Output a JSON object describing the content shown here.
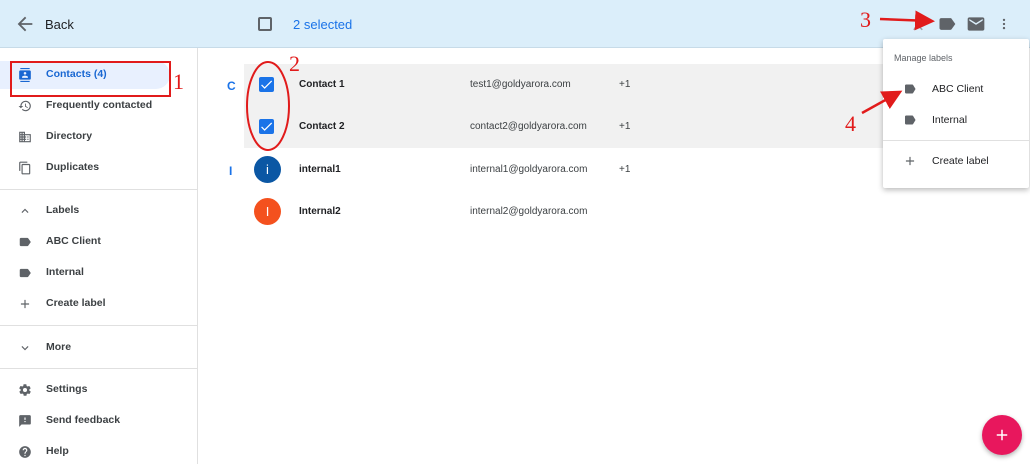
{
  "header": {
    "back_label": "Back",
    "selected_count": "2 selected",
    "icons": [
      "back-arrow-icon",
      "checkbox-icon",
      "merge-icon",
      "label-icon",
      "mail-icon",
      "more-vert-icon"
    ]
  },
  "sidebar": {
    "items": [
      {
        "label": "Contacts (4)",
        "icon": "contacts-icon",
        "active": true
      },
      {
        "label": "Frequently contacted",
        "icon": "history-icon"
      },
      {
        "label": "Directory",
        "icon": "directory-icon"
      },
      {
        "label": "Duplicates",
        "icon": "copy-icon"
      }
    ],
    "labels_section": {
      "title": "Labels",
      "items": [
        {
          "label": "ABC Client",
          "icon": "label-icon"
        },
        {
          "label": "Internal",
          "icon": "label-icon"
        },
        {
          "label": "Create label",
          "icon": "plus-icon"
        }
      ]
    },
    "more_label": "More",
    "bottom_items": [
      {
        "label": "Settings",
        "icon": "gear-icon"
      },
      {
        "label": "Send feedback",
        "icon": "feedback-icon"
      },
      {
        "label": "Help",
        "icon": "help-icon"
      }
    ]
  },
  "contacts": {
    "groups": [
      {
        "letter": "C",
        "rows": [
          {
            "name": "Contact 1",
            "email": "test1@goldyarora.com",
            "phone": "+1",
            "selected": true
          },
          {
            "name": "Contact 2",
            "email": "contact2@goldyarora.com",
            "phone": "+1",
            "selected": true
          }
        ]
      },
      {
        "letter": "I",
        "rows": [
          {
            "name": "internal1",
            "email": "internal1@goldyarora.com",
            "phone": "+1",
            "avatar_letter": "i",
            "avatar_color": "#0b57a4"
          },
          {
            "name": "Internal2",
            "email": "internal2@goldyarora.com",
            "phone": "",
            "avatar_letter": "I",
            "avatar_color": "#f4511e"
          }
        ]
      }
    ]
  },
  "label_menu": {
    "title": "Manage labels",
    "items": [
      {
        "label": "ABC Client",
        "icon": "label-icon"
      },
      {
        "label": "Internal",
        "icon": "label-icon"
      }
    ],
    "create_label": "Create label"
  },
  "annotations": {
    "numbers": [
      "1",
      "2",
      "3",
      "4"
    ],
    "color": "#e11b1b"
  },
  "colors": {
    "header_bg": "#dbeefa",
    "accent": "#1a73e8",
    "fab": "#e8175d",
    "selected_row_bg": "#f1f1f1"
  }
}
